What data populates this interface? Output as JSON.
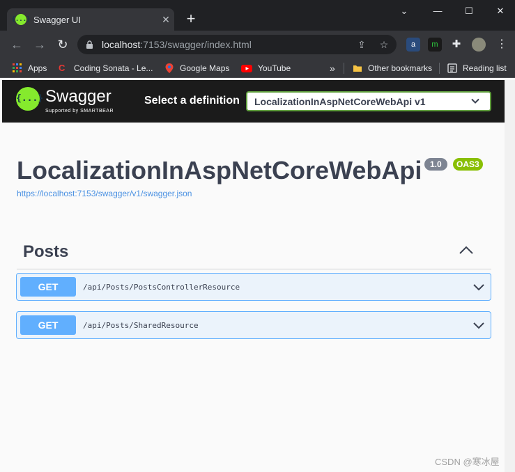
{
  "browser": {
    "tab_title": "Swagger UI",
    "tab_favicon": "{...}",
    "new_tab": "+",
    "url_host": "localhost",
    "url_rest": ":7153/swagger/index.html",
    "bookmarks": [
      {
        "label": "Apps",
        "icon": "apps-grid-icon"
      },
      {
        "label": "Coding Sonata - Le...",
        "icon": "coding-sonata-icon"
      },
      {
        "label": "Google Maps",
        "icon": "maps-pin-icon"
      },
      {
        "label": "YouTube",
        "icon": "youtube-icon"
      }
    ],
    "more_bookmarks": "»",
    "other_bookmarks": "Other bookmarks",
    "reading_list": "Reading list"
  },
  "swagger": {
    "logo_glyph": "{...}",
    "wordmark": "Swagger",
    "supported_by": "Supported by SMARTBEAR",
    "select_label": "Select a definition",
    "selected_definition": "LocalizationInAspNetCoreWebApi v1",
    "api_title": "LocalizationInAspNetCoreWebApi",
    "version": "1.0",
    "oas": "OAS3",
    "spec_url": "https://localhost:7153/swagger/v1/swagger.json",
    "tag": "Posts",
    "operations": [
      {
        "method": "GET",
        "path": "/api/Posts/PostsControllerResource"
      },
      {
        "method": "GET",
        "path": "/api/Posts/SharedResource"
      }
    ]
  },
  "watermark": "CSDN @寒冰屋",
  "colors": {
    "swagger_green": "#85ea2d",
    "get_blue": "#61affe",
    "oas_badge": "#89bf04",
    "version_badge": "#7d8492"
  }
}
